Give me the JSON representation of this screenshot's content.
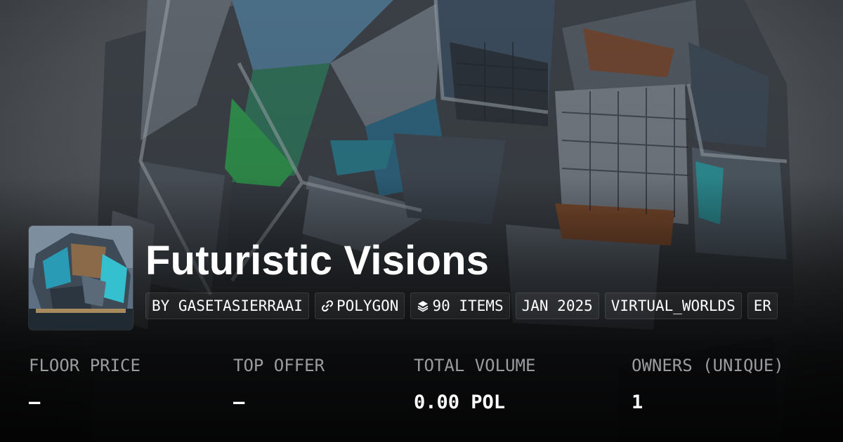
{
  "collection": {
    "title": "Futuristic Visions",
    "tags": [
      {
        "text": "BY GASETASIERRAAI",
        "icon": null
      },
      {
        "text": "POLYGON",
        "icon": "link-icon"
      },
      {
        "text": "90 ITEMS",
        "icon": "layers-icon"
      },
      {
        "text": "JAN 2025",
        "icon": null
      },
      {
        "text": "VIRTUAL_WORLDS",
        "icon": null
      },
      {
        "text": "ER",
        "icon": null
      }
    ]
  },
  "stats": [
    {
      "label": "FLOOR PRICE",
      "value": "–"
    },
    {
      "label": "TOP OFFER",
      "value": "–"
    },
    {
      "label": "TOTAL VOLUME",
      "value": "0.00 POL"
    },
    {
      "label": "OWNERS (UNIQUE)",
      "value": "1"
    }
  ],
  "colors": {
    "text": "#ffffff",
    "muted_label": "#9a9ca0",
    "background": "#1b1d20"
  }
}
